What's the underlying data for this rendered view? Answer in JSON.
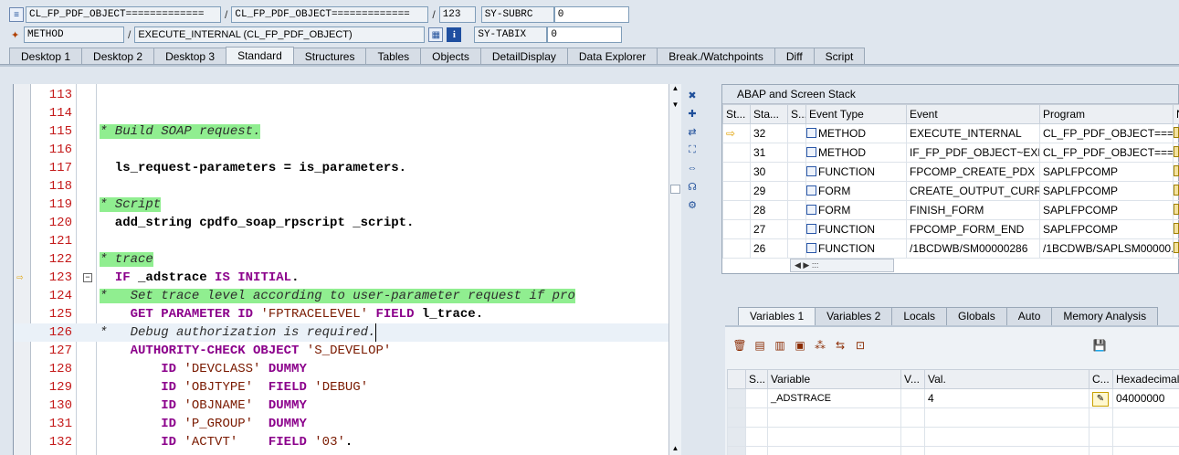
{
  "header": {
    "object1": "CL_FP_PDF_OBJECT=============",
    "object2": "CL_FP_PDF_OBJECT=============",
    "line_no": "123",
    "subrc_label": "SY-SUBRC",
    "subrc_value": "0",
    "type": "METHOD",
    "event": "EXECUTE_INTERNAL (CL_FP_PDF_OBJECT)",
    "tabix_label": "SY-TABIX",
    "tabix_value": "0",
    "sep": "/"
  },
  "tabs": [
    "Desktop 1",
    "Desktop 2",
    "Desktop 3",
    "Standard",
    "Structures",
    "Tables",
    "Objects",
    "DetailDisplay",
    "Data Explorer",
    "Break./Watchpoints",
    "Diff",
    "Script"
  ],
  "active_tab": "Standard",
  "code_lines": [
    {
      "n": "113",
      "html": ""
    },
    {
      "n": "114",
      "html": ""
    },
    {
      "n": "115",
      "html": "<span class=\"cm cmhl\">* Build SOAP request.</span>"
    },
    {
      "n": "116",
      "html": ""
    },
    {
      "n": "117",
      "html": "  ls_request-parameters = is_parameters."
    },
    {
      "n": "118",
      "html": ""
    },
    {
      "n": "119",
      "html": "<span class=\"cm cmhl\">* Script</span>"
    },
    {
      "n": "120",
      "html": "  add_string cpdfo_soap_rpscript _script."
    },
    {
      "n": "121",
      "html": ""
    },
    {
      "n": "122",
      "html": "<span class=\"cm cmhl\">* trace</span>"
    },
    {
      "n": "123",
      "html": "  <span class=\"kw\">IF</span> _adstrace <span class=\"kw\">IS INITIAL</span>."
    },
    {
      "n": "124",
      "html": "<span class=\"cm\">*   Set trace level according to user-parameter request if pro</span>"
    },
    {
      "n": "125",
      "html": "    <span class=\"kw\">GET PARAMETER ID</span> <span class=\"st\">'FPTRACELEVEL'</span> <span class=\"kw\">FIELD</span> l_trace."
    },
    {
      "n": "126",
      "html": "<span class=\"cm\">*   Debug authorization is required.</span>"
    },
    {
      "n": "127",
      "html": "    <span class=\"kw\">AUTHORITY-CHECK OBJECT</span> <span class=\"st\">'S_DEVELOP'</span>"
    },
    {
      "n": "128",
      "html": "        <span class=\"kw\">ID</span> <span class=\"st\">'DEVCLASS'</span> <span class=\"kw\">DUMMY</span>"
    },
    {
      "n": "129",
      "html": "        <span class=\"kw\">ID</span> <span class=\"st\">'OBJTYPE'</span>  <span class=\"kw\">FIELD</span> <span class=\"st\">'DEBUG'</span>"
    },
    {
      "n": "130",
      "html": "        <span class=\"kw\">ID</span> <span class=\"st\">'OBJNAME'</span>  <span class=\"kw\">DUMMY</span>"
    },
    {
      "n": "131",
      "html": "        <span class=\"kw\">ID</span> <span class=\"st\">'P_GROUP'</span>  <span class=\"kw\">DUMMY</span>"
    },
    {
      "n": "132",
      "html": "        <span class=\"kw\">ID</span> <span class=\"st\">'ACTVT'</span>    <span class=\"kw\">FIELD</span> <span class=\"st\">'03'</span>."
    }
  ],
  "current_line": "123",
  "stack": {
    "title": "ABAP and Screen Stack",
    "columns": [
      "St...",
      "Sta...",
      "S...",
      "Event Type",
      "Event",
      "Program",
      "N"
    ],
    "rows": [
      {
        "cur": true,
        "level": "32",
        "type": "METHOD",
        "event": "EXECUTE_INTERNAL",
        "program": "CL_FP_PDF_OBJECT===..."
      },
      {
        "cur": false,
        "level": "31",
        "type": "METHOD",
        "event": "IF_FP_PDF_OBJECT~EXE...",
        "program": "CL_FP_PDF_OBJECT===..."
      },
      {
        "cur": false,
        "level": "30",
        "type": "FUNCTION",
        "event": "FPCOMP_CREATE_PDX",
        "program": "SAPLFPCOMP"
      },
      {
        "cur": false,
        "level": "29",
        "type": "FORM",
        "event": "CREATE_OUTPUT_CURR...",
        "program": "SAPLFPCOMP"
      },
      {
        "cur": false,
        "level": "28",
        "type": "FORM",
        "event": "FINISH_FORM",
        "program": "SAPLFPCOMP"
      },
      {
        "cur": false,
        "level": "27",
        "type": "FUNCTION",
        "event": "FPCOMP_FORM_END",
        "program": "SAPLFPCOMP"
      },
      {
        "cur": false,
        "level": "26",
        "type": "FUNCTION",
        "event": "/1BCDWB/SM00000286",
        "program": "/1BCDWB/SAPLSM00000..."
      }
    ],
    "hscroll_label": "◀ ▶      :::"
  },
  "vartabs": [
    "Variables 1",
    "Variables 2",
    "Locals",
    "Globals",
    "Auto",
    "Memory Analysis"
  ],
  "active_vartab": "Variables 1",
  "vars": {
    "columns": [
      "S...",
      "Variable",
      "V...",
      "Val.",
      "C...",
      "Hexadecimal"
    ],
    "rows": [
      {
        "variable": "_ADSTRACE",
        "value": "4",
        "hex": "04000000"
      }
    ]
  },
  "colors": {
    "comment_highlight": "#90ee90",
    "keyword": "#8b008b",
    "line_number": "#c41a1a"
  }
}
